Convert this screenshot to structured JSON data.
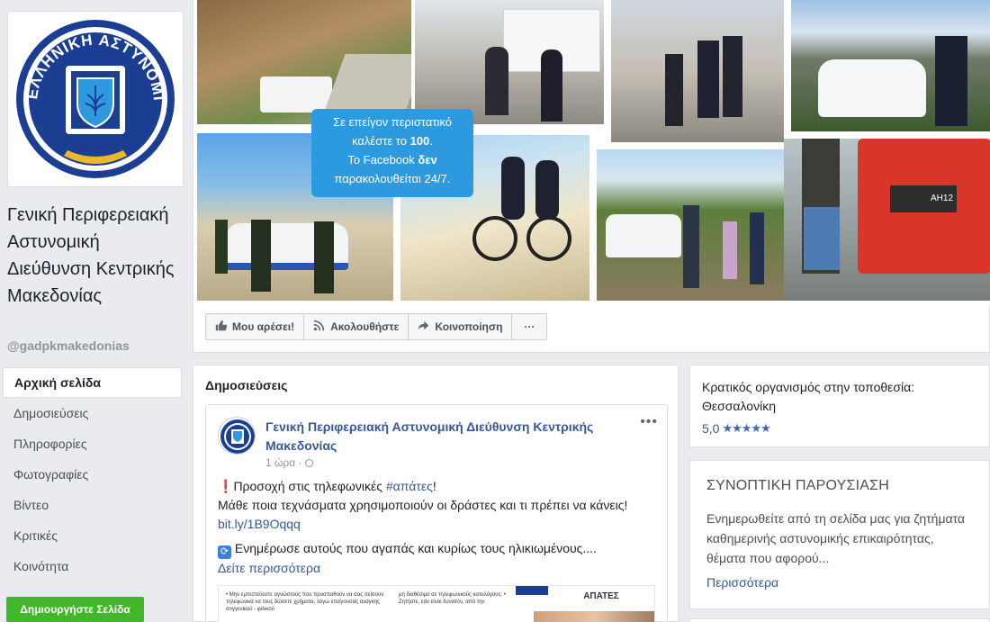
{
  "page": {
    "name": "Γενική Περιφερειακή Αστυνομική Διεύθυνση Κεντρικής Μακεδονίας",
    "handle": "@gadpkmakedonias",
    "logo_text": "ΕΛΛΗΝΙΚΗ ΑΣΤΥΝΟΜΙΑ"
  },
  "nav": {
    "items": [
      "Αρχική σελίδα",
      "Δημοσιεύσεις",
      "Πληροφορίες",
      "Φωτογραφίες",
      "Βίντεο",
      "Κριτικές",
      "Κοινότητα"
    ],
    "create_page": "Δημιουργήστε Σελίδα"
  },
  "cover": {
    "notice_line1": "Σε επείγον περιστατικό",
    "notice_line2a": "καλέστε το",
    "notice_line2b": "100",
    "notice_line3a": "Το Facebook",
    "notice_line3b": "δεν",
    "notice_line4": "παρακολουθείται 24/7.",
    "truck_text": "ΑΗ12"
  },
  "actions": {
    "like": "Μου αρέσει!",
    "follow": "Ακολουθήστε",
    "share": "Κοινοποίηση",
    "more": "···"
  },
  "posts": {
    "header": "Δημοσιεύσεις",
    "post": {
      "author": "Γενική Περιφερειακή Αστυνομική Διεύθυνση Κεντρικής Μακεδονίας",
      "time": "1 ώρα · ",
      "line1_prefix": "Προσοχή στις τηλεφωνικές ",
      "hashtag": "#απάτες",
      "line1_suffix": "!",
      "line2": "Μάθε ποια τεχνάσματα χρησιμοποιούν οι δράστες και τι πρέπει να κάνεις! ",
      "short_link": "bit.ly/1B9Oqqq",
      "line3": " Ενημέρωσε αυτούς που αγαπάς και κυρίως τους ηλικιωμένους....",
      "see_more": "Δείτε περισσότερα",
      "img_heading": "ΑΠΑΤΕΣ",
      "img_col1": "• Μην εμπιστεύεστε αγνώστους που προσπαθούν να σας πείσουν τηλεφωνικά να τους δώσετε χρήματα, λόγω επείγουσας ανάγκης συγγενικού - φιλικού",
      "img_col2": "μη διαθέσιμο σε τηλεφωνικούς καταλόγους. • Ζητήστε, εάν είναι δυνατόν, από την"
    }
  },
  "info": {
    "category": "Κρατικός οργανισμός στην τοποθεσία: Θεσσαλονίκη",
    "rating": "5,0",
    "stars": "★★★★★"
  },
  "about": {
    "heading": "ΣΥΝΟΠΤΙΚΗ ΠΑΡΟΥΣΙΑΣΗ",
    "text": "Ενημερωθείτε από τη σελίδα μας για ζητήματα καθημερινής αστυνομικής επικαιρότητας, θέματα που αφορού...",
    "more": "Περισσότερα"
  },
  "colors": {
    "link": "#365899",
    "notice_bg": "#2d9ae0",
    "create_btn": "#42b72a"
  }
}
